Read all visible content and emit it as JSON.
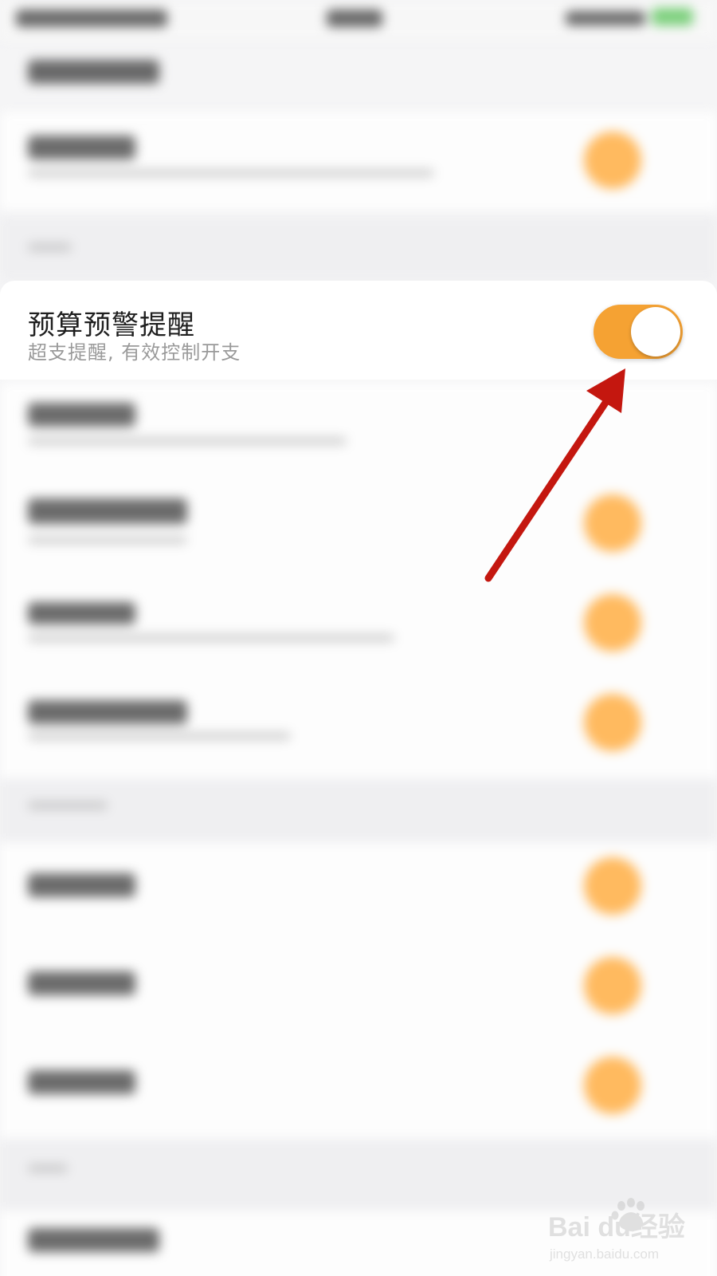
{
  "setting_row": {
    "title": "预算预警提醒",
    "subtitle": "超支提醒, 有效控制开支",
    "toggle_state": "on"
  },
  "colors": {
    "toggle_on": "#f5a233",
    "annotation_arrow": "#c4170f",
    "background": "#f5f5f6"
  },
  "watermark": {
    "logo": "Baidu经验",
    "url": "jingyan.baidu.com"
  }
}
